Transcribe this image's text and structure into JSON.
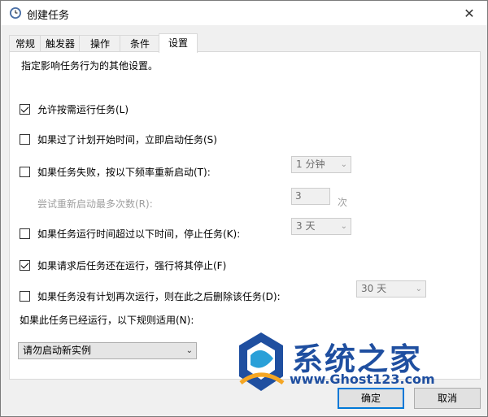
{
  "window": {
    "title": "创建任务",
    "close_glyph": "✕"
  },
  "tabs": [
    {
      "label": "常规",
      "active": false
    },
    {
      "label": "触发器",
      "active": false
    },
    {
      "label": "操作",
      "active": false
    },
    {
      "label": "条件",
      "active": false
    },
    {
      "label": "设置",
      "active": true
    }
  ],
  "settings": {
    "description": "指定影响任务行为的其他设置。",
    "allow_on_demand": {
      "label": "允许按需运行任务(L)",
      "checked": true
    },
    "run_asap_after_missed": {
      "label": "如果过了计划开始时间，立即启动任务(S)",
      "checked": false
    },
    "restart_on_fail": {
      "label": "如果任务失败，按以下频率重新启动(T):",
      "checked": false,
      "interval": "1 分钟"
    },
    "restart_attempts": {
      "label": "尝试重新启动最多次数(R):",
      "value": "3",
      "unit": "次"
    },
    "stop_if_runs_longer": {
      "label": "如果任务运行时间超过以下时间，停止任务(K):",
      "checked": false,
      "duration": "3 天"
    },
    "force_stop": {
      "label": "如果请求后任务还在运行，强行将其停止(F)",
      "checked": true
    },
    "delete_if_not_scheduled": {
      "label": "如果任务没有计划再次运行，则在此之后删除该任务(D):",
      "checked": false,
      "duration": "30 天"
    },
    "if_running_rule": {
      "label": "如果此任务已经运行，以下规则适用(N):",
      "value": "请勿启动新实例"
    }
  },
  "buttons": {
    "ok": "确定",
    "cancel": "取消"
  },
  "watermark": {
    "name": "系统之家",
    "url": "www.Ghost123.com"
  },
  "colors": {
    "accent": "#0078d7",
    "watermark": "#1f4fa0"
  },
  "icons": {
    "title": "task-scheduler-clock-icon",
    "close": "close-icon",
    "dropdown": "chevron-down-icon"
  }
}
